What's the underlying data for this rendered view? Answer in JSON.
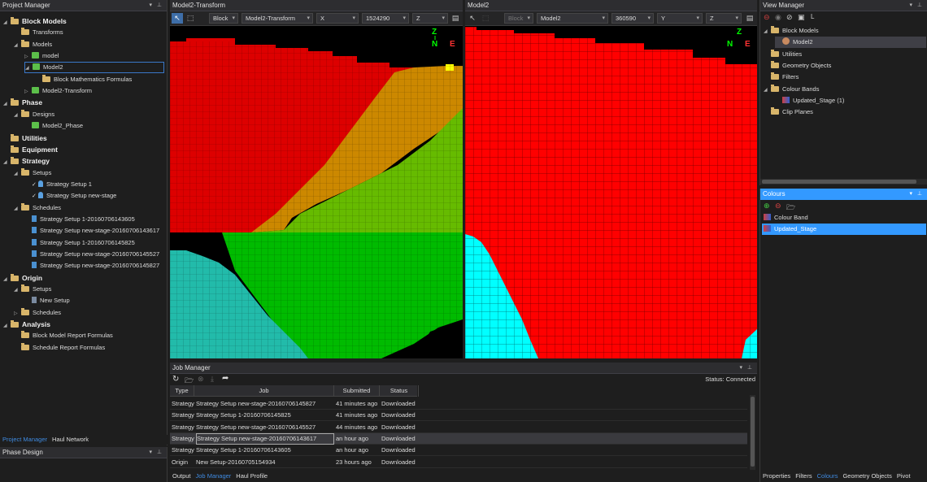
{
  "project_manager": {
    "title": "Project Manager",
    "tree": [
      {
        "label": "Block Models",
        "icon": "folder-icon",
        "bold": true,
        "depth": 0,
        "arrow": "expanded"
      },
      {
        "label": "Transforms",
        "icon": "folder-icon",
        "depth": 1
      },
      {
        "label": "Models",
        "icon": "folder-icon",
        "depth": 1,
        "arrow": "expanded"
      },
      {
        "label": "model",
        "icon": "block-model-icon",
        "depth": 2,
        "arrow": "collapsed"
      },
      {
        "label": "Model2",
        "icon": "block-model-icon",
        "depth": 2,
        "arrow": "expanded",
        "selected": true
      },
      {
        "label": "Block Mathematics Formulas",
        "icon": "folder-icon",
        "depth": 3
      },
      {
        "label": "Model2-Transform",
        "icon": "block-model-icon",
        "depth": 2,
        "arrow": "collapsed"
      },
      {
        "label": "Phase",
        "icon": "folder-icon",
        "bold": true,
        "depth": 0,
        "arrow": "expanded"
      },
      {
        "label": "Designs",
        "icon": "folder-icon",
        "depth": 1,
        "arrow": "expanded"
      },
      {
        "label": "Model2_Phase",
        "icon": "block-model-icon",
        "depth": 2
      },
      {
        "label": "Utilities",
        "icon": "folder-icon",
        "bold": true,
        "depth": 0
      },
      {
        "label": "Equipment",
        "icon": "folder-icon",
        "bold": true,
        "depth": 0
      },
      {
        "label": "Strategy",
        "icon": "folder-icon",
        "bold": true,
        "depth": 0,
        "arrow": "expanded"
      },
      {
        "label": "Setups",
        "icon": "folder-icon",
        "depth": 1,
        "arrow": "expanded"
      },
      {
        "label": "Strategy Setup 1",
        "icon": "strategy-setup-icon",
        "depth": 2,
        "checked": true
      },
      {
        "label": "Strategy Setup new-stage",
        "icon": "strategy-setup-icon",
        "depth": 2,
        "checked": true
      },
      {
        "label": "Schedules",
        "icon": "folder-icon",
        "depth": 1,
        "arrow": "expanded"
      },
      {
        "label": "Strategy Setup 1-20160706143605",
        "icon": "schedule-icon",
        "depth": 2
      },
      {
        "label": "Strategy Setup new-stage-20160706143617",
        "icon": "schedule-icon",
        "depth": 2
      },
      {
        "label": "Strategy Setup 1-20160706145825",
        "icon": "schedule-icon",
        "depth": 2
      },
      {
        "label": "Strategy Setup new-stage-20160706145527",
        "icon": "schedule-icon",
        "depth": 2
      },
      {
        "label": "Strategy Setup new-stage-20160706145827",
        "icon": "schedule-icon",
        "depth": 2
      },
      {
        "label": "Origin",
        "icon": "folder-icon",
        "bold": true,
        "depth": 0,
        "arrow": "expanded"
      },
      {
        "label": "Setups",
        "icon": "folder-icon",
        "depth": 1,
        "arrow": "expanded"
      },
      {
        "label": "New Setup",
        "icon": "origin-setup-icon",
        "depth": 2
      },
      {
        "label": "Schedules",
        "icon": "folder-icon",
        "depth": 1,
        "arrow": "collapsed"
      },
      {
        "label": "Analysis",
        "icon": "folder-icon",
        "bold": true,
        "depth": 0,
        "arrow": "expanded"
      },
      {
        "label": "Block Model Report Formulas",
        "icon": "folder-icon",
        "depth": 1
      },
      {
        "label": "Schedule Report Formulas",
        "icon": "folder-icon",
        "depth": 1
      }
    ],
    "bottom_tabs": [
      "Project Manager",
      "Haul Network"
    ],
    "active_tab": "Project Manager"
  },
  "phase_design": {
    "title": "Phase Design"
  },
  "viewport_left": {
    "title": "Model2-Transform",
    "toolbar": {
      "mode": "Block",
      "model": "Model2-Transform",
      "axis": "X",
      "value": "1524290",
      "axis2": "Z"
    },
    "compass": {
      "up": "Z",
      "north": "N",
      "east": "E"
    }
  },
  "viewport_right": {
    "title": "Model2",
    "toolbar": {
      "mode": "Block",
      "model": "Model2",
      "value": "360590",
      "axis": "Y",
      "axis2": "Z"
    },
    "compass": {
      "up": "Z",
      "north": "N",
      "east": "E"
    }
  },
  "job_manager": {
    "title": "Job Manager",
    "status": "Status: Connected",
    "columns": [
      "Type",
      "Job",
      "Submitted",
      "Status"
    ],
    "rows": [
      {
        "type": "Strategy",
        "job": "Strategy Setup new-stage-20160706145827",
        "submitted": "41 minutes ago",
        "status": "Downloaded"
      },
      {
        "type": "Strategy",
        "job": "Strategy Setup 1-20160706145825",
        "submitted": "41 minutes ago",
        "status": "Downloaded"
      },
      {
        "type": "Strategy",
        "job": "Strategy Setup new-stage-20160706145527",
        "submitted": "44 minutes ago",
        "status": "Downloaded"
      },
      {
        "type": "Strategy",
        "job": "Strategy Setup new-stage-20160706143617",
        "submitted": "an hour ago",
        "status": "Downloaded",
        "selected": true
      },
      {
        "type": "Strategy",
        "job": "Strategy Setup 1-20160706143605",
        "submitted": "an hour ago",
        "status": "Downloaded"
      },
      {
        "type": "Origin",
        "job": "New Setup-20160705154934",
        "submitted": "23 hours ago",
        "status": "Downloaded"
      }
    ],
    "bottom_tabs": [
      "Output",
      "Job Manager",
      "Haul Profile"
    ],
    "active_tab": "Job Manager"
  },
  "view_manager": {
    "title": "View Manager",
    "toolbar_label": "L",
    "tree": [
      {
        "label": "Block Models",
        "icon": "folder-icon",
        "depth": 0,
        "arrow": "expanded"
      },
      {
        "label": "Model2",
        "icon": "model-sphere-icon",
        "depth": 1,
        "selected": true
      },
      {
        "label": "Utilities",
        "icon": "folder-icon",
        "depth": 0
      },
      {
        "label": "Geometry Objects",
        "icon": "folder-icon",
        "depth": 0
      },
      {
        "label": "Filters",
        "icon": "folder-icon",
        "depth": 0
      },
      {
        "label": "Colour Bands",
        "icon": "folder-icon",
        "depth": 0,
        "arrow": "expanded"
      },
      {
        "label": "Updated_Stage (1)",
        "icon": "colour-band-icon",
        "depth": 1
      },
      {
        "label": "Clip Planes",
        "icon": "folder-icon",
        "depth": 0
      }
    ]
  },
  "colours": {
    "title": "Colours",
    "items": [
      {
        "label": "Colour Band",
        "selected": false
      },
      {
        "label": "Updated_Stage",
        "selected": true
      }
    ],
    "bottom_tabs": [
      "Properties",
      "Filters",
      "Colours",
      "Geometry Objects",
      "Pivot"
    ],
    "active_tab": "Colours"
  },
  "colors": {
    "accent": "#3399ff",
    "selection": "#3e6ea8",
    "red": "#ff0000",
    "dark_red": "#cc0000",
    "orange": "#cc8800",
    "light_green": "#66cc00",
    "green": "#00bb00",
    "teal": "#22bbaa",
    "cyan": "#00ffff",
    "yellow": "#ffff00"
  }
}
